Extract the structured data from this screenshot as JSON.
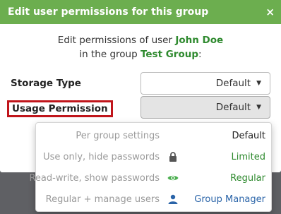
{
  "dialog": {
    "title": "Edit user permissions for this group",
    "close": "×",
    "intro_prefix": "Edit permissions of user",
    "user_name": "John Doe",
    "intro_mid": "in the group",
    "group_name": "Test Group",
    "intro_suffix": ":"
  },
  "fields": {
    "storage_type": {
      "label": "Storage Type",
      "value": "Default"
    },
    "usage_permission": {
      "label": "Usage Permission",
      "value": "Default"
    }
  },
  "menu": {
    "items": [
      {
        "description": "Per group settings",
        "icon": "none",
        "value": "Default"
      },
      {
        "description": "Use only, hide passwords",
        "icon": "lock-icon",
        "value": "Limited"
      },
      {
        "description": "Read-write, show passwords",
        "icon": "eye-icon",
        "value": "Regular"
      },
      {
        "description": "Regular + manage users",
        "icon": "user-icon",
        "value": "Group Manager"
      }
    ]
  },
  "colors": {
    "header": "#6cae4f",
    "accent_green": "#2f8a2f",
    "manager_blue": "#2a64a8",
    "highlight_red": "#c0151b"
  }
}
